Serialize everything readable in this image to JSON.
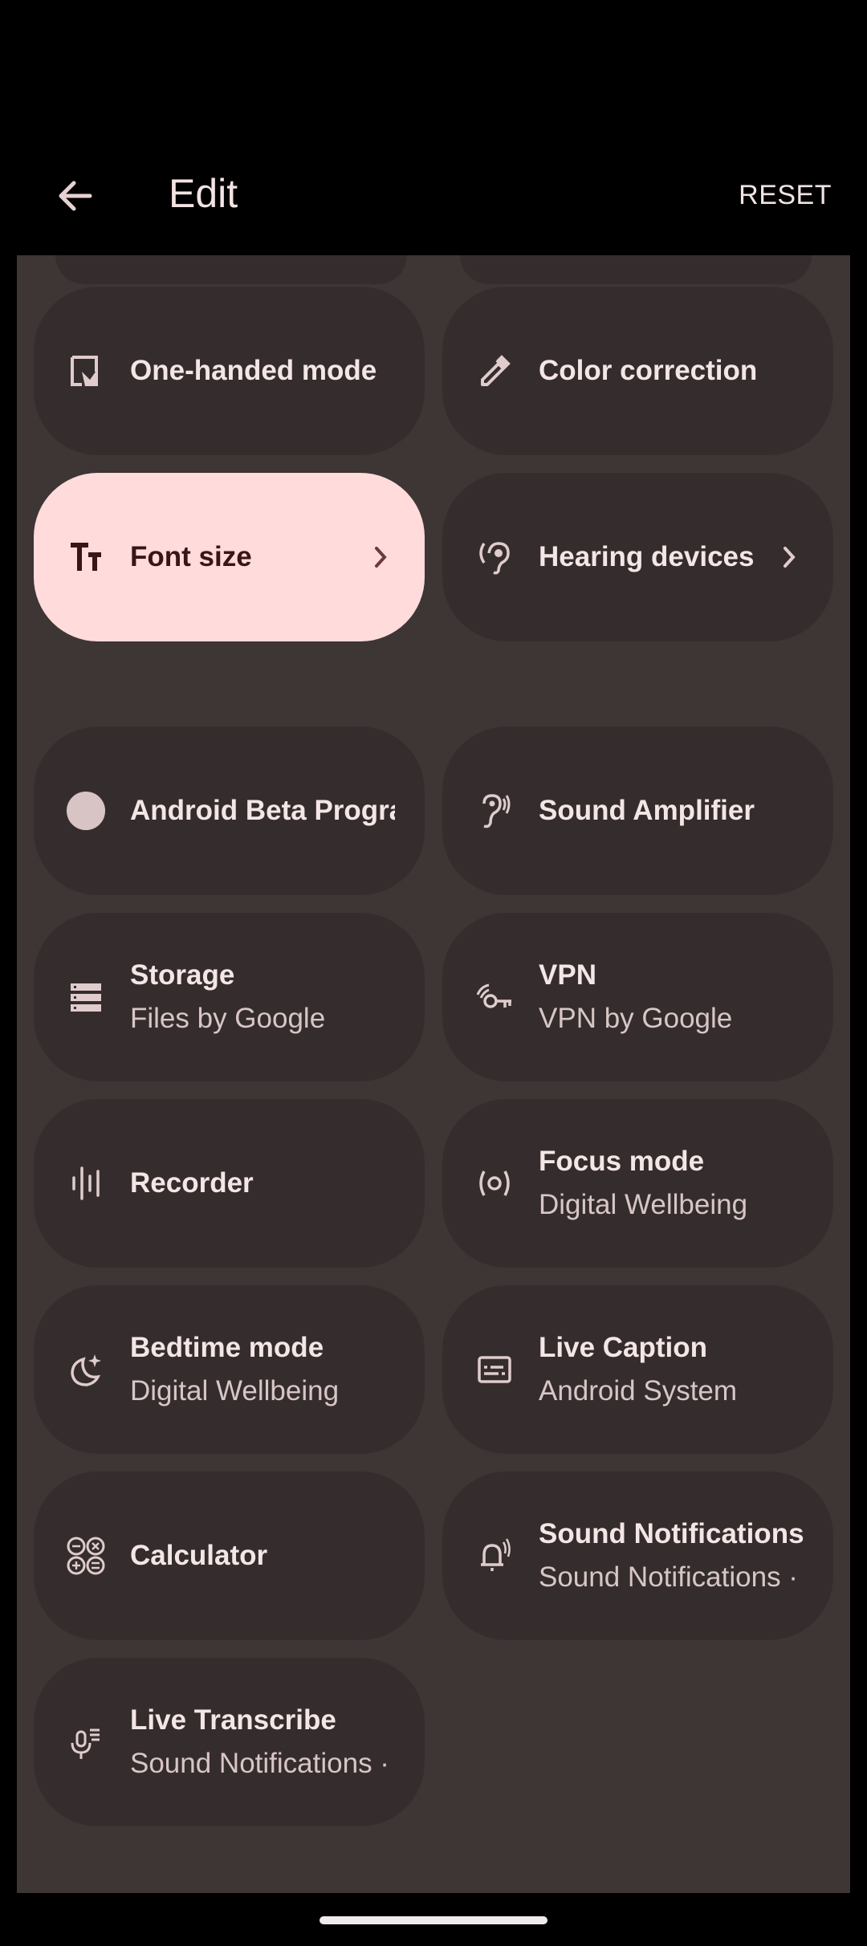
{
  "header": {
    "title": "Edit",
    "reset_label": "RESET"
  },
  "colors": {
    "panel": "#3e3535",
    "tile": "#352d2d",
    "active_tile": "#ffdbdb",
    "text": "#f5e6e6"
  },
  "tiles": [
    {
      "label": "One-handed mode",
      "icon": "one-handed-icon"
    },
    {
      "label": "Color correction",
      "icon": "eyedropper-icon"
    },
    {
      "label": "Font size",
      "icon": "font-size-icon",
      "active": true,
      "chevron": true
    },
    {
      "label": "Hearing devices",
      "icon": "hearing-device-icon",
      "chevron": true
    },
    {
      "label": "Android Beta Program",
      "icon": "circle-icon"
    },
    {
      "label": "Sound Amplifier",
      "icon": "ear-icon"
    },
    {
      "label": "Storage",
      "sub": "Files by Google",
      "icon": "storage-icon"
    },
    {
      "label": "VPN",
      "sub": "VPN by Google",
      "icon": "vpn-key-icon"
    },
    {
      "label": "Recorder",
      "icon": "waveform-icon"
    },
    {
      "label": "Focus mode",
      "sub": "Digital Wellbeing",
      "icon": "focus-icon"
    },
    {
      "label": "Bedtime mode",
      "sub": "Digital Wellbeing",
      "icon": "moon-icon"
    },
    {
      "label": "Live Caption",
      "sub": "Android System",
      "icon": "caption-icon"
    },
    {
      "label": "Calculator",
      "icon": "calculator-icon"
    },
    {
      "label": "Sound Notifications",
      "sub": "Sound Notifications · Live Transcribe",
      "icon": "bell-icon"
    },
    {
      "label": "Live Transcribe",
      "sub": "Sound Notifications · Live Transcribe",
      "icon": "mic-transcribe-icon"
    }
  ]
}
